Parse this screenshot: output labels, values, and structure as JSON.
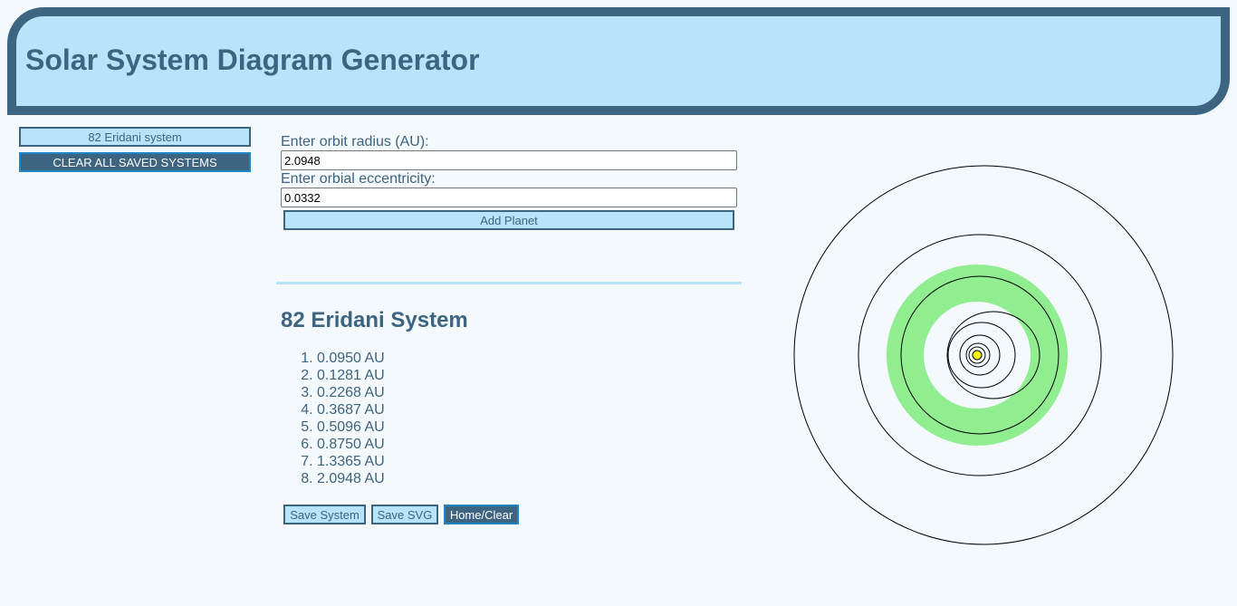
{
  "app": {
    "title": "Solar System Diagram Generator"
  },
  "saved_systems": {
    "items": [
      {
        "label": "82 Eridani system"
      }
    ],
    "clear_label": "CLEAR ALL SAVED SYSTEMS"
  },
  "form": {
    "radius_label": "Enter orbit radius (AU):",
    "radius_value": "2.0948",
    "eccentricity_label": "Enter orbial eccentricity:",
    "eccentricity_value": "0.0332",
    "add_label": "Add Planet"
  },
  "system": {
    "title": "82 Eridani System",
    "planets": [
      "0.0950 AU",
      "0.1281 AU",
      "0.2268 AU",
      "0.3687 AU",
      "0.5096 AU",
      "0.8750 AU",
      "1.3365 AU",
      "2.0948 AU"
    ]
  },
  "actions": {
    "save_system": "Save System",
    "save_svg": "Save SVG",
    "home_clear": "Home/Clear"
  },
  "colors": {
    "primary": "#3d6480",
    "light": "#b7e3fb",
    "background": "#f3f9fd",
    "habitable_zone": "#90ee90",
    "star": "#ffff00"
  }
}
